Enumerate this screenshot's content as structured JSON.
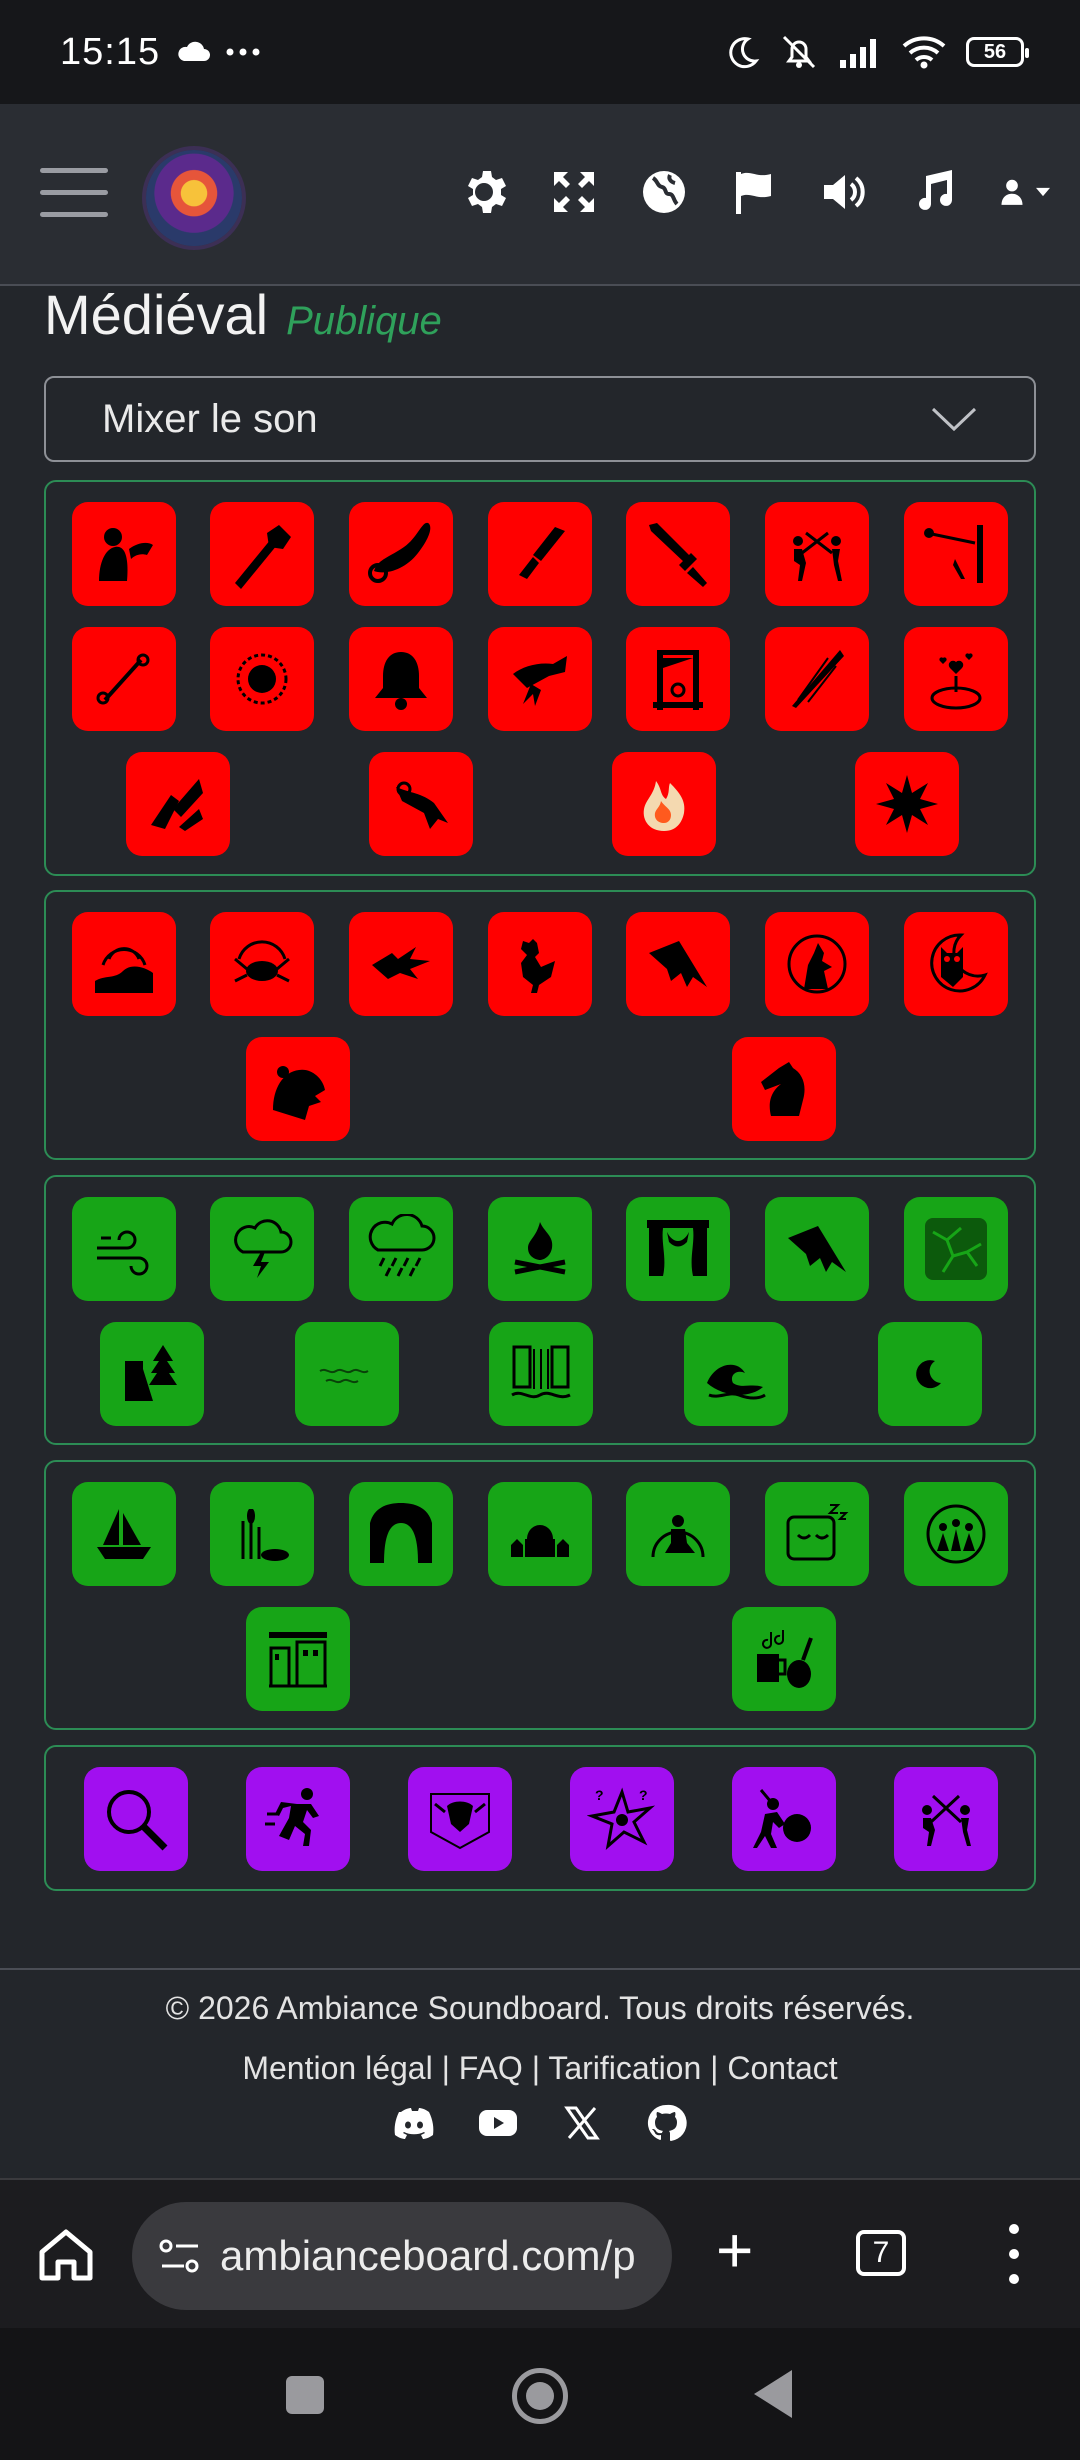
{
  "status_bar": {
    "time": "15:15",
    "battery": "56",
    "icons": [
      "cloud-icon",
      "more-dots-icon",
      "moon-icon",
      "bell-off-icon",
      "signal-icon",
      "wifi-icon",
      "battery-icon"
    ]
  },
  "header": {
    "icons": [
      "menu-icon",
      "app-logo",
      "settings-gear-icon",
      "fullscreen-icon",
      "globe-icon",
      "flag-icon",
      "volume-icon",
      "music-note-icon",
      "user-icon",
      "caret-down-icon"
    ]
  },
  "page": {
    "title": "Médiéval",
    "visibility_tag": "Publique",
    "mixer_label": "Mixer le son"
  },
  "groups": [
    {
      "color": "#ff0000",
      "sounds": [
        "barbarian-horn-icon",
        "club-icon",
        "war-horn-icon",
        "knife-icon",
        "sword-strike-icon",
        "sword-duel-icon",
        "arrow-target-icon",
        "bone-icon",
        "vortex-icon",
        "bell-icon",
        "magic-hand-icon",
        "guillotine-icon",
        "slash-icon",
        "love-potion-icon",
        "shards-icon",
        "dragon-breath-icon",
        "fire-spell-icon",
        "explosion-icon"
      ]
    },
    {
      "color": "#ff0000",
      "sounds": [
        "earthquake-icon",
        "crab-icon",
        "dragon-icon",
        "rooster-icon",
        "bat-wing-icon",
        "wolf-howl-icon",
        "owl-icon",
        "bear-roar-icon",
        "horse-icon"
      ]
    },
    {
      "color": "#17a517",
      "sounds": [
        "wind-icon",
        "thunderstorm-icon",
        "rain-icon",
        "campfire-icon",
        "theater-curtain-icon",
        "wing-icon",
        "cracked-ground-icon",
        "forest-icon",
        "water-ripple-icon",
        "waterfall-icon",
        "wave-icon",
        "night-moon-icon"
      ]
    },
    {
      "color": "#17a517",
      "sounds": [
        "ship-icon",
        "swamp-reeds-icon",
        "cave-icon",
        "village-icon",
        "prayer-icon",
        "sleep-icon",
        "crowd-party-icon",
        "town-street-icon",
        "tavern-music-icon"
      ]
    },
    {
      "color": "#a10ff0",
      "sounds": [
        "search-icon",
        "running-man-icon",
        "heraldry-icon",
        "confusion-shuriken-icon",
        "shield-warrior-icon",
        "fencing-icon"
      ]
    }
  ],
  "footer": {
    "copyright": "© 2026 Ambiance Soundboard. Tous droits réservés.",
    "links": [
      "Mention légal",
      "FAQ",
      "Tarification",
      "Contact"
    ],
    "separator": " | ",
    "social_icons": [
      "discord-icon",
      "youtube-icon",
      "x-icon",
      "github-icon"
    ]
  },
  "browser": {
    "url": "ambianceboard.com/p",
    "tab_count": "7"
  }
}
